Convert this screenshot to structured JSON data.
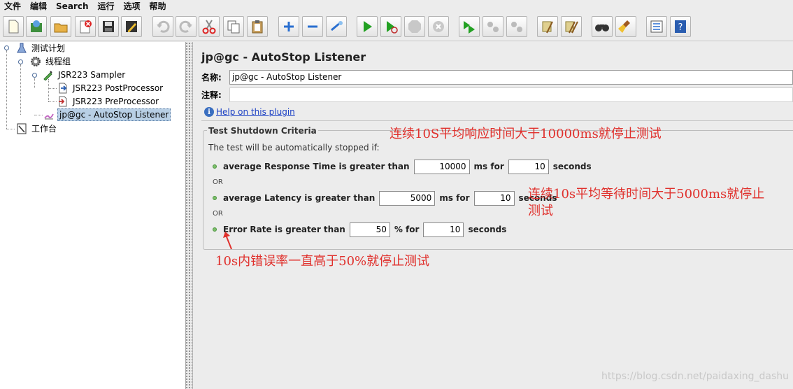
{
  "menu": [
    "文件",
    "编辑",
    "Search",
    "运行",
    "选项",
    "帮助"
  ],
  "toolbar_icons": [
    "new-icon",
    "templates-icon",
    "open-icon",
    "close-icon",
    "save-icon",
    "save-as-icon",
    "undo-icon",
    "redo-icon",
    "cut-icon",
    "copy-icon",
    "paste-icon",
    "expand-icon",
    "collapse-icon",
    "toggle-icon",
    "start-icon",
    "start-no-pauses-icon",
    "stop-icon",
    "shutdown-icon",
    "remote-start-icon",
    "remote-stop-icon",
    "remote-shutdown-icon",
    "clear-icon",
    "clear-all-icon",
    "search-icon",
    "reset-search-icon",
    "function-helper-icon",
    "help-icon"
  ],
  "tree": {
    "test_plan": "测试计划",
    "thread_group": "线程组",
    "sampler": "JSR223 Sampler",
    "post_processor": "JSR223 PostProcessor",
    "pre_processor": "JSR223 PreProcessor",
    "listener": "jp@gc - AutoStop Listener",
    "workbench": "工作台"
  },
  "panel": {
    "title": "jp@gc - AutoStop Listener",
    "name_label": "名称:",
    "name_value": "jp@gc - AutoStop Listener",
    "comment_label": "注释:",
    "comment_value": "",
    "help_icon_glyph": "i",
    "help_link": "Help on this plugin"
  },
  "criteria": {
    "legend": "Test Shutdown Criteria",
    "description": "The test will be automatically stopped if:",
    "or_label": "OR",
    "rt": {
      "label": "average Response Time is greater than",
      "value": "10000",
      "unit": "ms for",
      "period": "10",
      "suffix": "seconds"
    },
    "latency": {
      "label": "average Latency is greater than",
      "value": "5000",
      "unit": "ms for",
      "period": "10",
      "suffix": "seconds"
    },
    "error": {
      "label": "Error Rate is greater than",
      "value": "50",
      "unit": "% for",
      "period": "10",
      "suffix": "seconds"
    }
  },
  "annotations": {
    "rt": "连续10S平均响应时间大于10000ms就停止测试",
    "latency_line1": "连续10s平均等待时间大于5000ms就停止",
    "latency_line2": "测试",
    "error": "10s内错误率一直高于50%就停止测试",
    "color": "#e0302c"
  },
  "watermark": "https://blog.csdn.net/paidaxing_dashu"
}
